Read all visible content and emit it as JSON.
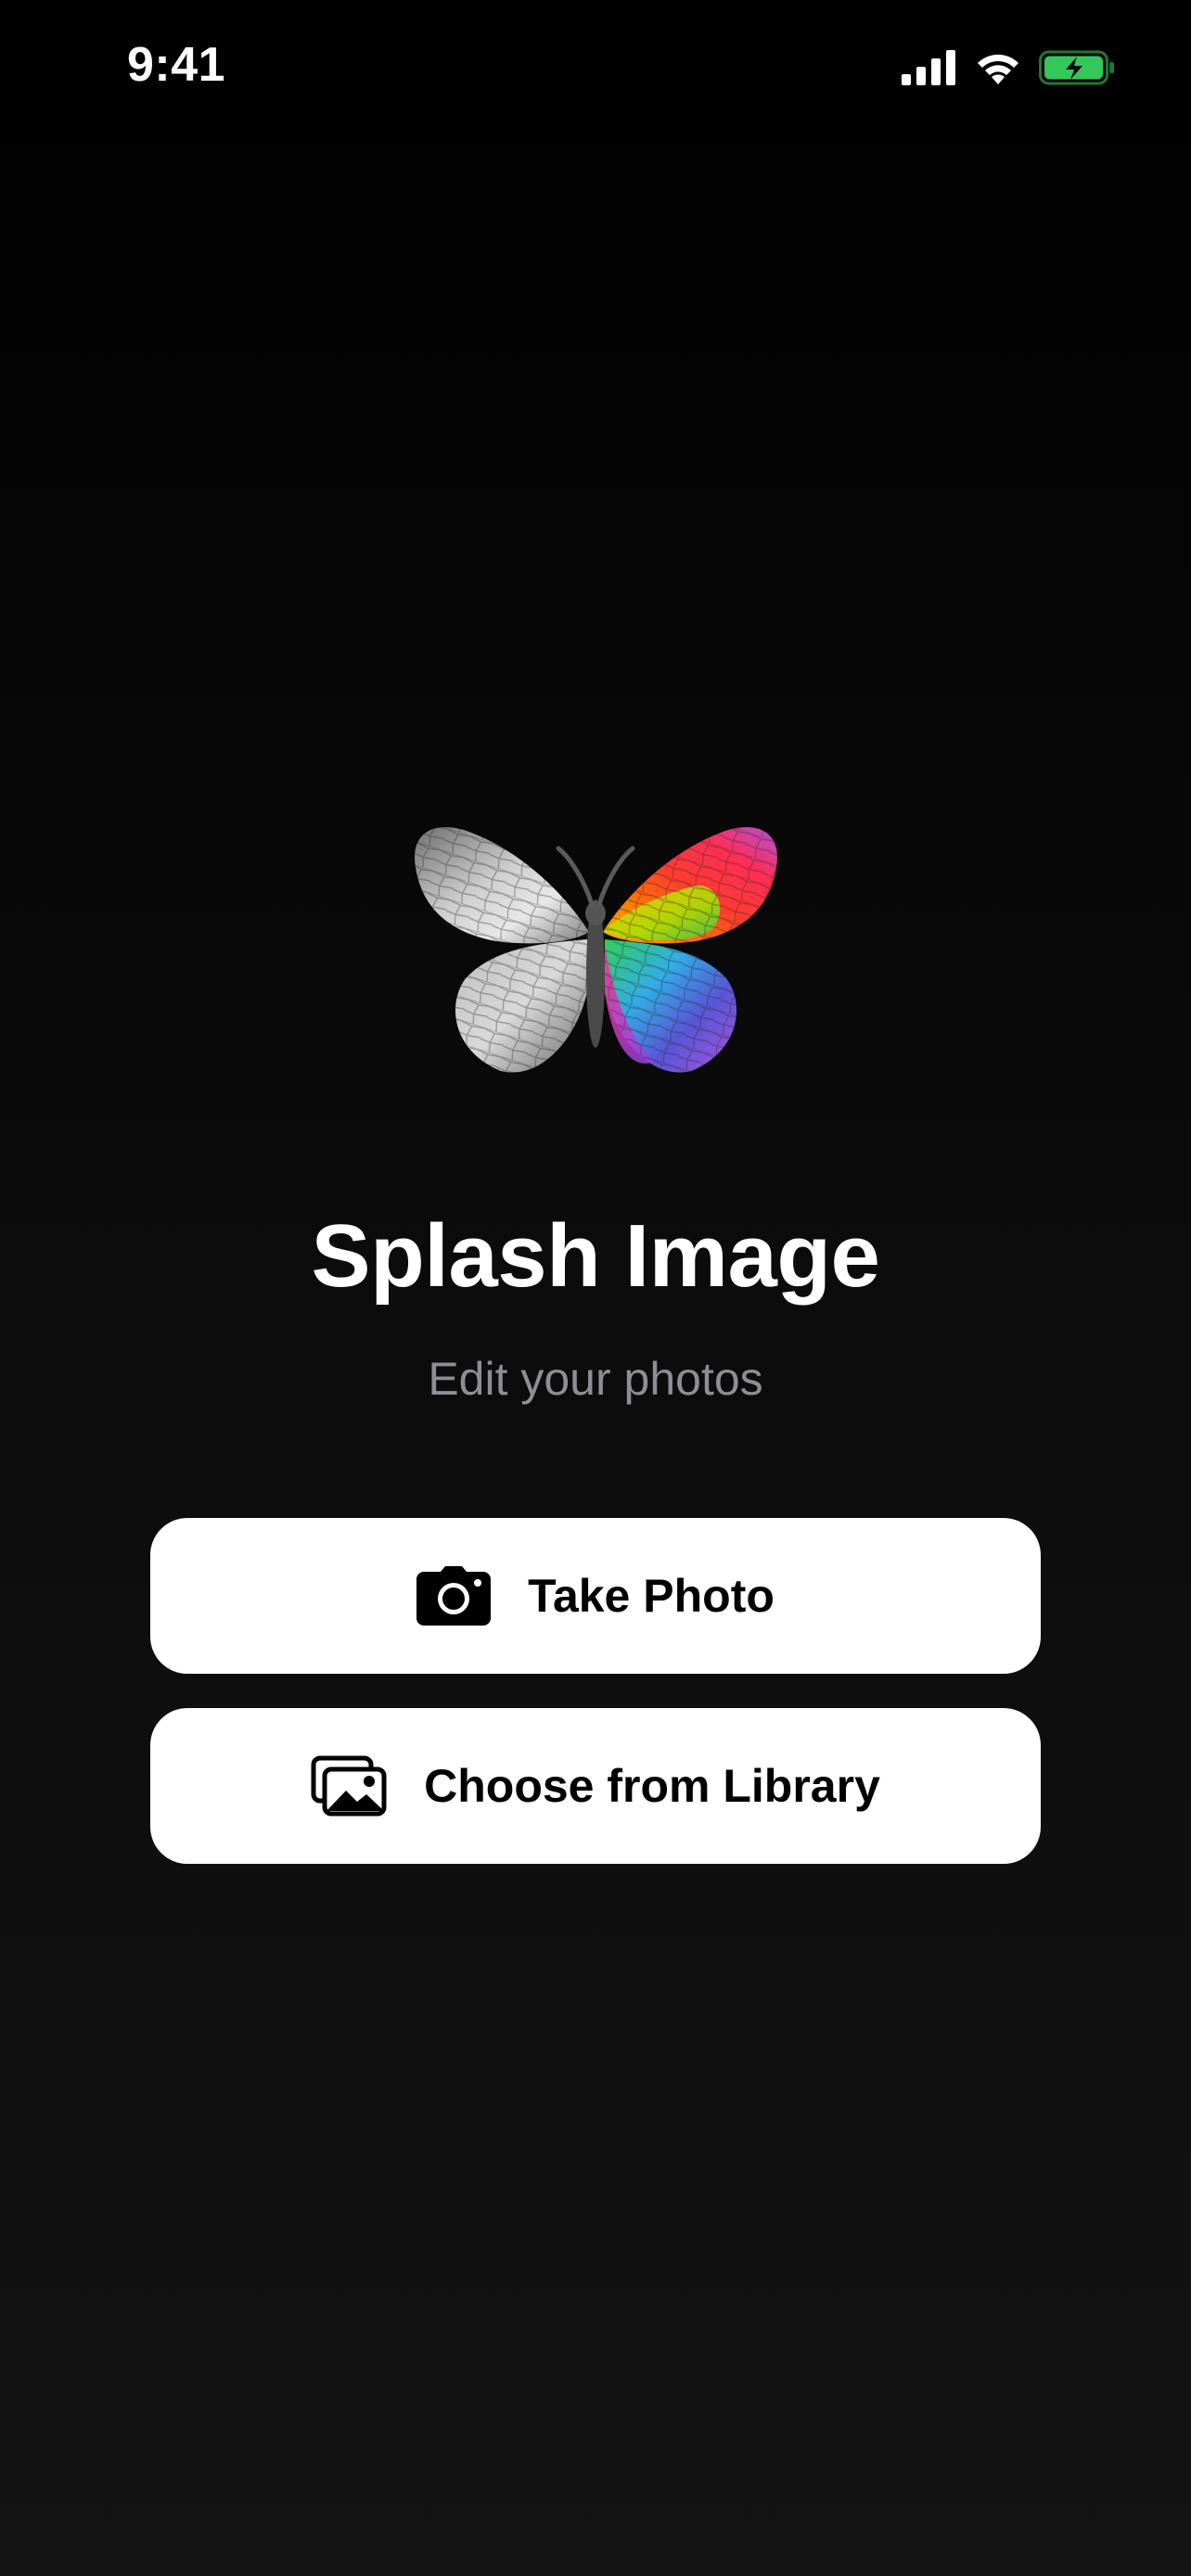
{
  "status_bar": {
    "time": "9:41",
    "icons": [
      "cellular-signal-icon",
      "wifi-icon",
      "battery-charging-icon"
    ],
    "battery_color": "#34c759"
  },
  "app": {
    "logo_icon": "butterfly-logo-icon",
    "title": "Splash Image",
    "subtitle": "Edit your photos"
  },
  "actions": {
    "take_photo": {
      "label": "Take Photo",
      "icon": "camera-icon"
    },
    "choose_library": {
      "label": "Choose from Library",
      "icon": "photo-library-icon"
    }
  },
  "colors": {
    "background": "#000000",
    "button_bg": "#ffffff",
    "subtitle": "#8e8e93"
  }
}
